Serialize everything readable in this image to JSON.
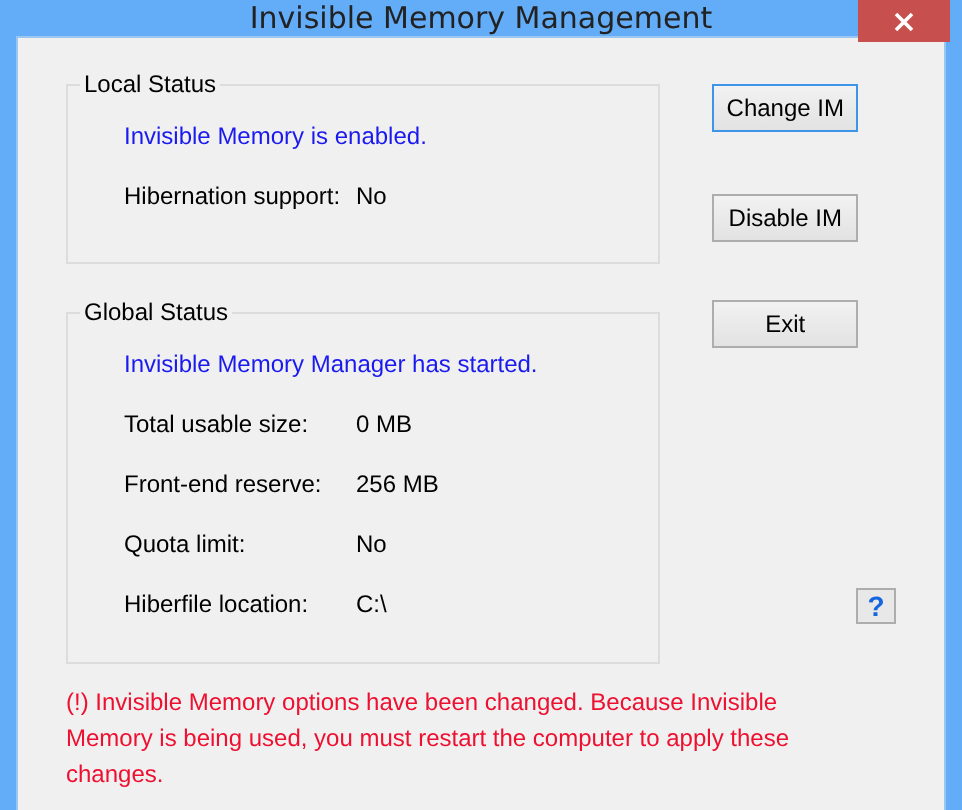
{
  "window": {
    "title": "Invisible Memory Management"
  },
  "local_status": {
    "title": "Local Status",
    "message": "Invisible Memory is enabled.",
    "rows": [
      {
        "label": "Hibernation support:",
        "value": "No"
      }
    ]
  },
  "global_status": {
    "title": "Global Status",
    "message": "Invisible Memory Manager has started.",
    "rows": [
      {
        "label": "Total usable size:",
        "value": "0 MB"
      },
      {
        "label": "Front-end reserve:",
        "value": "256 MB"
      },
      {
        "label": "Quota limit:",
        "value": "No"
      },
      {
        "label": "Hiberfile location:",
        "value": "C:\\"
      }
    ]
  },
  "buttons": [
    {
      "label": "Change IM",
      "focused": true
    },
    {
      "label": "Disable IM",
      "focused": false
    },
    {
      "label": "Exit",
      "focused": false
    }
  ],
  "help_button": {
    "label": "?"
  },
  "warning": "(!) Invisible Memory options have been changed. Because Invisible Memory is being used, you must restart the computer to apply these changes."
}
